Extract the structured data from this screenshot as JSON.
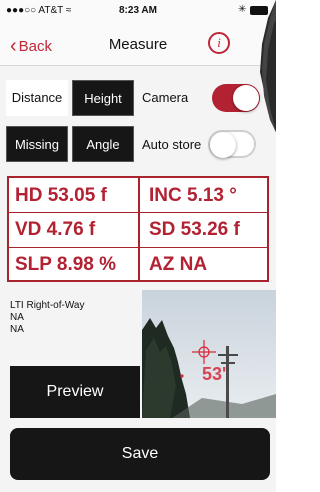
{
  "status_bar": {
    "carrier": "●●●○○ AT&T ≈",
    "time": "8:23 AM",
    "bluetooth": "✳"
  },
  "nav": {
    "back_label": "Back",
    "title": "Measure",
    "info_label": "i"
  },
  "modes": {
    "distance": "Distance",
    "height": "Height",
    "missing": "Missing",
    "angle": "Angle"
  },
  "toggles": {
    "camera_label": "Camera",
    "camera_on": true,
    "auto_store_label": "Auto store",
    "auto_store_on": false
  },
  "readings": {
    "hd": "HD 53.05 f",
    "inc": "INC  5.13 °",
    "vd": "VD 4.76 f",
    "sd": "SD 53.26 f",
    "slp": "SLP 8.98 %",
    "az": "AZ NA"
  },
  "details": {
    "line1": "LTI Right-of-Way",
    "line2": "NA",
    "line3": "NA"
  },
  "photo_overlay_value": "53'",
  "buttons": {
    "preview": "Preview",
    "save": "Save"
  },
  "colors": {
    "accent": "#b22233",
    "dark_button": "#161616"
  }
}
